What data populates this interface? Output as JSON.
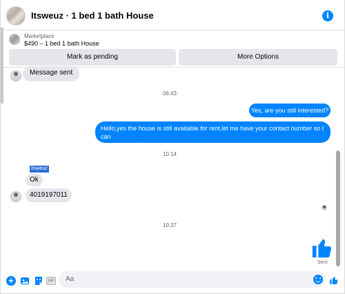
{
  "header": {
    "title": "Itsweuz · 1 bed 1 bath House"
  },
  "marketplace": {
    "label": "Marketplace",
    "listing": "$490 – 1 bed 1 bath House",
    "buttons": {
      "mark_pending": "Mark as pending",
      "more_options": "More Options"
    }
  },
  "messages": {
    "first_in": "Message sent",
    "time_1": "06:43",
    "out_1": "Yes, are you still interested?",
    "out_2_line_1": "Hello,yes the house is still available for rent,let me have your contact number so I can",
    "out_2_line_2": "send you details and the requirements about the house",
    "time_2": "10:14",
    "sender_name": "Itsweuz",
    "in_ok": "Ok",
    "in_phone": "4019197011",
    "time_3": "10:37",
    "sent_status": "Sent"
  },
  "composer": {
    "placeholder": "Aa"
  },
  "colors": {
    "accent": "#0084ff",
    "bubble_incoming": "#e4e6eb"
  },
  "icons": [
    "info-icon",
    "plus-icon",
    "photo-icon",
    "sticker-icon",
    "gif-icon",
    "emoji-icon",
    "thumbs-up-icon"
  ]
}
